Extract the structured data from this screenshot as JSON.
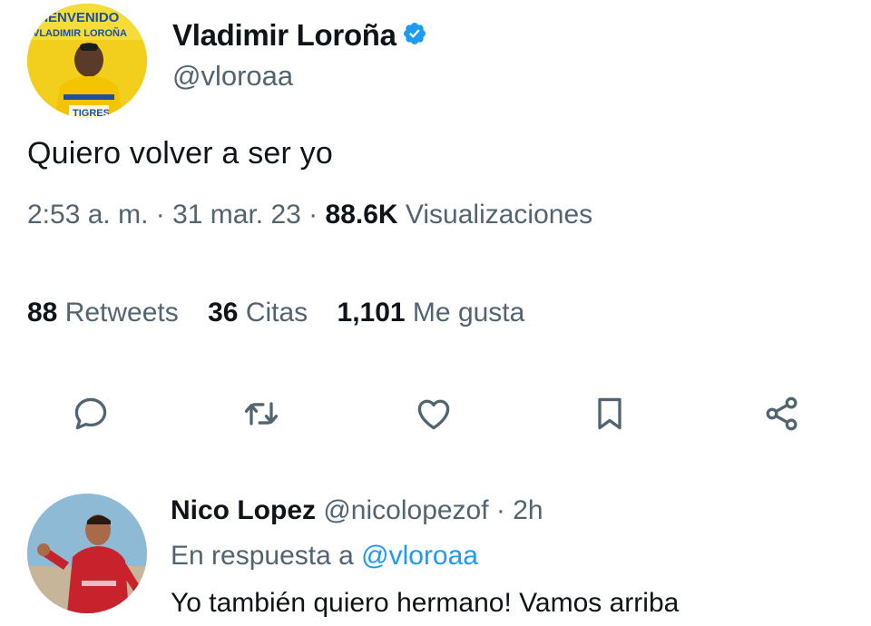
{
  "tweet": {
    "avatar": {
      "icon": "profile-photo",
      "banner_text_1": "BIENVENIDO",
      "banner_text_2": "VLADIMIR LOROÑA",
      "shirt_text": "TIGRES"
    },
    "display_name": "Vladimir Loroña",
    "verified_icon": "verified-badge-icon",
    "handle": "@vloroaa",
    "text": "Quiero volver a ser yo",
    "time": "2:53 a. m.",
    "sep1": " · ",
    "date": "31 mar. 23",
    "sep2": " · ",
    "views_count": "88.6K",
    "views_label": " Visualizaciones",
    "stats": {
      "retweets_count": "88",
      "retweets_label": " Retweets",
      "quotes_count": "36",
      "quotes_label": " Citas",
      "likes_count": "1,101",
      "likes_label": " Me gusta"
    },
    "actions": [
      "reply-icon",
      "retweet-icon",
      "like-icon",
      "bookmark-icon",
      "share-icon"
    ]
  },
  "reply": {
    "avatar": {
      "icon": "profile-photo"
    },
    "display_name": "Nico Lopez",
    "handle": " @nicolopezof",
    "sep": " · ",
    "time": "2h",
    "replying_to_label": "En respuesta a ",
    "replying_to_handle": "@vloroaa",
    "text": "Yo también quiero hermano! Vamos arriba"
  },
  "colors": {
    "text_primary": "#0f1419",
    "text_secondary": "#536471",
    "accent": "#1d9bf0",
    "verified": "#1d9bf0"
  }
}
